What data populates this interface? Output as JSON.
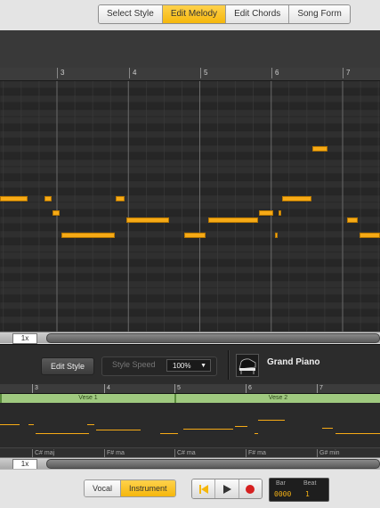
{
  "tabs": [
    {
      "label": "Select Style",
      "active": false
    },
    {
      "label": "Edit Melody",
      "active": true
    },
    {
      "label": "Edit Chords",
      "active": false
    },
    {
      "label": "Song Form",
      "active": false
    }
  ],
  "roll": {
    "ruler_numbers": [
      "3",
      "4",
      "5",
      "6",
      "7"
    ],
    "zoom_label": "1x"
  },
  "style_panel": {
    "edit_style_label": "Edit Style",
    "style_speed_label": "Style Speed",
    "style_speed_value": "100%",
    "instrument_name": "Grand Piano"
  },
  "overview": {
    "ruler_numbers": [
      "3",
      "4",
      "5",
      "6",
      "7"
    ],
    "sections": [
      "Vese 1",
      "Vese 2"
    ],
    "chords": [
      "C# maj",
      "F# ma",
      "C# ma",
      "F# ma",
      "G# min"
    ],
    "zoom_label": "1x"
  },
  "transport": {
    "vocal_label": "Vocal",
    "instrument_label": "Instrument",
    "active_mode": "Instrument",
    "bar_label": "Bar",
    "beat_label": "Beat",
    "bar_value": "0000",
    "beat_value": "1"
  },
  "colors": {
    "accent": "#f5b70c",
    "note": "#f6aa16",
    "record": "#d62020",
    "section": "#9fc97f"
  }
}
